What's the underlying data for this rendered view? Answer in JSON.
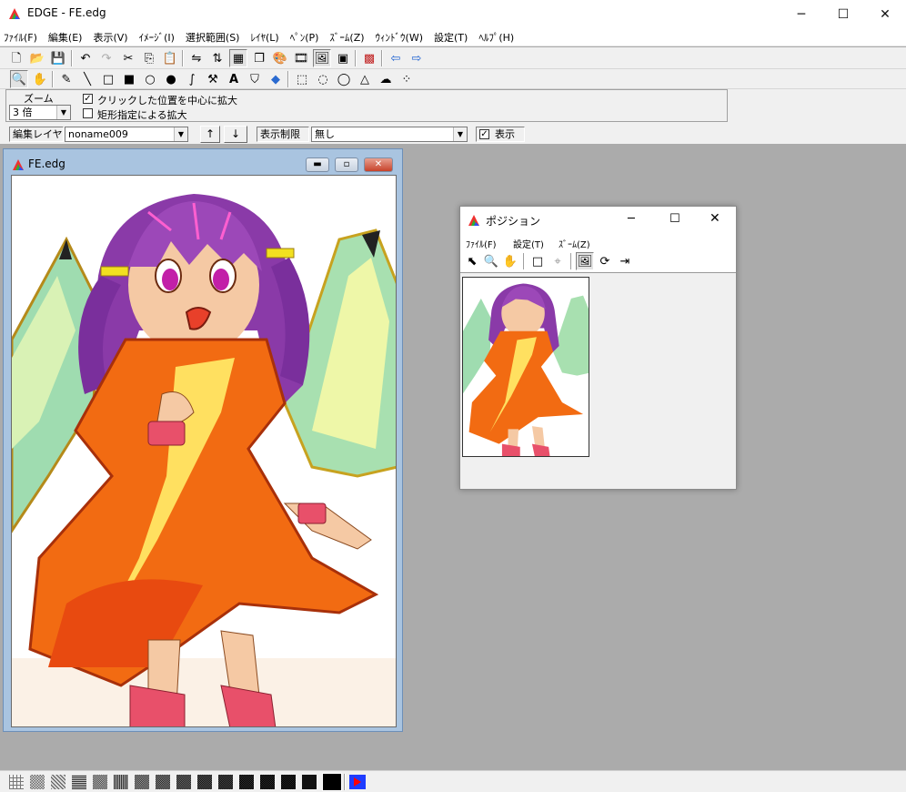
{
  "app": {
    "title": "EDGE - FE.edg",
    "controls": {
      "minimize": "─",
      "maximize": "☐",
      "close": "✕"
    }
  },
  "menu": [
    "ﾌｧｲﾙ(F)",
    "編集(E)",
    "表示(V)",
    "ｲﾒｰｼﾞ(I)",
    "選択範囲(S)",
    "ﾚｲﾔ(L)",
    "ﾍﾟﾝ(P)",
    "ｽﾞｰﾑ(Z)",
    "ｳｨﾝﾄﾞｳ(W)",
    "設定(T)",
    "ﾍﾙﾌﾟ(H)"
  ],
  "toolbar1": [
    "new-file-icon",
    "open-folder-icon",
    "save-disk-icon",
    "undo-icon",
    "redo-icon",
    "cut-icon",
    "copy-icon",
    "paste-icon",
    "flip-horizontal-icon",
    "flip-vertical-icon",
    "grid-icon",
    "layers-icon",
    "palette-icon",
    "film-icon",
    "image-view-icon",
    "frame-icon",
    "pixel-grid-icon",
    "arrow-left-icon",
    "arrow-right-icon"
  ],
  "toolbar2": [
    "zoom-icon",
    "hand-icon",
    "pen-icon",
    "line-icon",
    "rect-icon",
    "filled-rect-icon",
    "circle-icon",
    "filled-circle-icon",
    "curve-icon",
    "text-icon",
    "hammer-icon",
    "bucket-icon",
    "fill-icon",
    "select-rect-icon",
    "select-circle-icon",
    "select-lasso-icon",
    "select-polygon-icon",
    "select-blob-icon",
    "select-magic-icon"
  ],
  "zoom_panel": {
    "group_label": "ズーム",
    "zoom_value": "3 倍",
    "option1": "クリックした位置を中心に拡大",
    "option2": "矩形指定による拡大",
    "option1_checked": "✓",
    "option2_checked": ""
  },
  "layer_bar": {
    "label": "編集レイヤ",
    "layer_value": "noname009",
    "up": "↑",
    "down": "↓",
    "limit_label": "表示制限",
    "limit_value": "無し",
    "show_check": "✓",
    "show_label": "表示"
  },
  "doc_window": {
    "title": "FE.edg",
    "min": "▬",
    "max": "▫",
    "close": "✕"
  },
  "position_window": {
    "title": "ポジション",
    "menu": [
      "ﾌｧｲﾙ(F)",
      "設定(T)",
      "ｽﾞｰﾑ(Z)"
    ],
    "controls": {
      "minimize": "─",
      "maximize": "☐",
      "close": "✕"
    },
    "tools": [
      "pointer-icon",
      "magnifier-icon",
      "hand-icon",
      "frame-icon",
      "crosshair-icon",
      "picture-icon",
      "refresh-icon",
      "export-icon"
    ]
  },
  "status_patterns": 16,
  "colors": {
    "fg": "#000000",
    "bg": "#ff0000",
    "bg2": "#1e3cff",
    "hair": "#8a3aa8",
    "dress": "#f26b12",
    "skin": "#f5c9a4",
    "wing": "#8fd6a8"
  }
}
